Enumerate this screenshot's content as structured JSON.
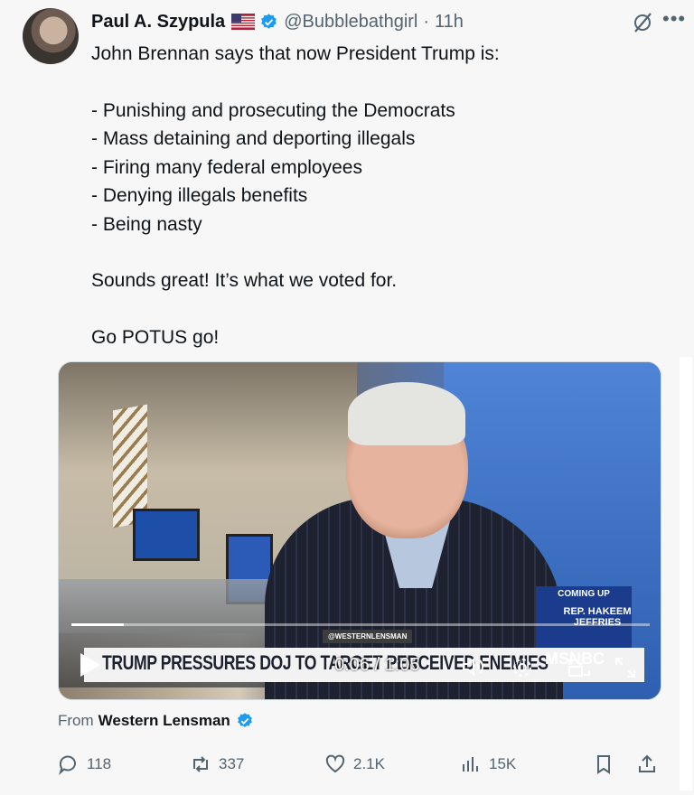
{
  "tweet": {
    "author_name": "Paul A. Szypula",
    "handle": "@Bubblebathgirl",
    "separator": "·",
    "time": "11h",
    "flag": "us-flag-icon",
    "text": {
      "intro": "John Brennan says that now President Trump is:",
      "items": [
        "- Punishing and prosecuting the Democrats",
        "- Mass detaining and deporting illegals",
        "- Firing many federal employees",
        "- Denying illegals benefits",
        "- Being nasty"
      ],
      "line2": "Sounds great! It’s what we voted for.",
      "line3": "Go POTUS go!"
    }
  },
  "video": {
    "chyron": "TRUMP PRESSURES DOJ TO TARGET PERCEIVED ENEMIES",
    "tag": "@WESTERNLENSMAN",
    "coming_up": "COMING UP",
    "guest": "REP. HAKEEM JEFFRIES",
    "network": "MSNBC",
    "current_time": "0:06",
    "duration": "1:05",
    "timecode": "0:06 / 1:05",
    "progress": 0.09
  },
  "from": {
    "prefix": "From",
    "source": "Western Lensman"
  },
  "actions": {
    "replies": "118",
    "reposts": "337",
    "likes": "2.1K",
    "views": "15K"
  },
  "colors": {
    "accent": "#1d9bf0",
    "muted": "#536471",
    "text": "#0f1419"
  }
}
